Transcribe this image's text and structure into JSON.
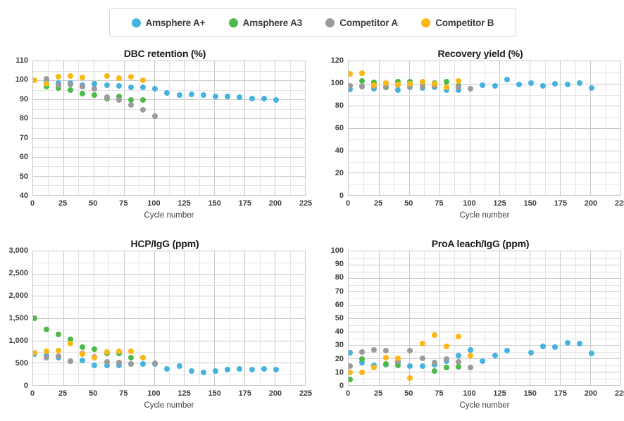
{
  "legend": {
    "items": [
      {
        "label": "Amsphere A+",
        "color": "#45b3e0",
        "key": "amsphere_a_plus"
      },
      {
        "label": "Amsphere A3",
        "color": "#4eb848",
        "key": "amsphere_a3"
      },
      {
        "label": "Competitor A",
        "color": "#9b9b9b",
        "key": "competitor_a"
      },
      {
        "label": "Competitor B",
        "color": "#fbb713",
        "key": "competitor_b"
      }
    ]
  },
  "colors": {
    "amsphere_a_plus": "#45b3e0",
    "amsphere_a3": "#4eb848",
    "competitor_a": "#9b9b9b",
    "competitor_b": "#fbb713",
    "grid_major": "#c9c9c9",
    "grid_minor": "#e4e4e4",
    "text": "#3f3f3f",
    "background": "#ffffff"
  },
  "chart_data": [
    {
      "id": "dbc",
      "type": "scatter",
      "title": "DBC retention (%)",
      "xlabel": "Cycle number",
      "ylabel": "",
      "xlim": [
        0,
        225
      ],
      "ylim": [
        40,
        110
      ],
      "xticks": [
        0,
        25,
        50,
        75,
        100,
        125,
        150,
        175,
        200,
        225
      ],
      "yticks": [
        40,
        50,
        60,
        70,
        80,
        90,
        100,
        110
      ],
      "grid": true,
      "legend_position": "top",
      "series": [
        {
          "name": "Amsphere A+",
          "color": "#45b3e0",
          "points": [
            [
              11,
              99.2
            ],
            [
              21,
              98.6
            ],
            [
              31,
              98.4
            ],
            [
              41,
              97.4
            ],
            [
              51,
              98.2
            ],
            [
              61,
              97.4
            ],
            [
              71,
              97.0
            ],
            [
              81,
              96.4
            ],
            [
              91,
              96.4
            ],
            [
              101,
              95.8
            ],
            [
              111,
              93.6
            ],
            [
              121,
              92.2
            ],
            [
              131,
              92.7
            ],
            [
              141,
              92.4
            ],
            [
              151,
              91.6
            ],
            [
              161,
              91.4
            ],
            [
              171,
              91.1
            ],
            [
              181,
              90.3
            ],
            [
              191,
              90.3
            ],
            [
              201,
              89.9
            ]
          ]
        },
        {
          "name": "Amsphere A3",
          "color": "#4eb848",
          "points": [
            [
              11,
              96.8
            ],
            [
              21,
              96.1
            ],
            [
              31,
              95.0
            ],
            [
              41,
              93.1
            ],
            [
              51,
              92.2
            ],
            [
              61,
              90.5
            ],
            [
              71,
              91.7
            ],
            [
              81,
              89.6
            ],
            [
              91,
              89.6
            ]
          ]
        },
        {
          "name": "Competitor A",
          "color": "#9b9b9b",
          "points": [
            [
              11,
              100.7
            ],
            [
              21,
              97.3
            ],
            [
              31,
              98.0
            ],
            [
              41,
              96.8
            ],
            [
              51,
              95.5
            ],
            [
              61,
              91.1
            ],
            [
              71,
              89.6
            ],
            [
              81,
              87.2
            ],
            [
              91,
              84.5
            ],
            [
              101,
              81.4
            ]
          ]
        },
        {
          "name": "Competitor B",
          "color": "#fbb713",
          "points": [
            [
              1,
              99.9
            ],
            [
              11,
              98.3
            ],
            [
              21,
              101.8
            ],
            [
              31,
              102.3
            ],
            [
              41,
              101.5
            ],
            [
              61,
              102.4
            ],
            [
              71,
              101.2
            ],
            [
              81,
              102.0
            ],
            [
              91,
              100.2
            ]
          ]
        }
      ]
    },
    {
      "id": "recovery",
      "type": "scatter",
      "title": "Recovery yield (%)",
      "xlabel": "Cycle number",
      "ylabel": "",
      "xlim": [
        0,
        225
      ],
      "ylim": [
        0,
        120
      ],
      "xticks": [
        0,
        25,
        50,
        75,
        100,
        125,
        150,
        175,
        200,
        225
      ],
      "yticks": [
        0,
        20,
        40,
        60,
        80,
        100,
        120
      ],
      "grid": true,
      "legend_position": "top",
      "series": [
        {
          "name": "Amsphere A+",
          "color": "#45b3e0",
          "points": [
            [
              1,
              94.6
            ],
            [
              11,
              97.2
            ],
            [
              21,
              95.2
            ],
            [
              31,
              96.4
            ],
            [
              41,
              93.8
            ],
            [
              51,
              96.4
            ],
            [
              61,
              95.8
            ],
            [
              71,
              96.4
            ],
            [
              81,
              94.4
            ],
            [
              91,
              93.8
            ],
            [
              111,
              98.6
            ],
            [
              121,
              97.6
            ],
            [
              131,
              103.4
            ],
            [
              141,
              99.4
            ],
            [
              151,
              100.4
            ],
            [
              161,
              97.8
            ],
            [
              171,
              99.6
            ],
            [
              181,
              99.0
            ],
            [
              191,
              100.6
            ],
            [
              201,
              96.2
            ]
          ]
        },
        {
          "name": "Amsphere A3",
          "color": "#4eb848",
          "points": [
            [
              11,
              102.6
            ],
            [
              21,
              100.8
            ],
            [
              31,
              96.8
            ],
            [
              41,
              101.6
            ],
            [
              51,
              101.6
            ],
            [
              61,
              100.8
            ],
            [
              71,
              100.4
            ],
            [
              81,
              101.8
            ],
            [
              91,
              98.2
            ]
          ]
        },
        {
          "name": "Competitor A",
          "color": "#9b9b9b",
          "points": [
            [
              1,
              97.6
            ],
            [
              11,
              97.4
            ],
            [
              21,
              97.0
            ],
            [
              31,
              97.4
            ],
            [
              41,
              98.6
            ],
            [
              51,
              97.4
            ],
            [
              61,
              97.2
            ],
            [
              71,
              97.8
            ],
            [
              81,
              96.6
            ],
            [
              91,
              96.8
            ],
            [
              101,
              95.4
            ]
          ]
        },
        {
          "name": "Competitor B",
          "color": "#fbb713",
          "points": [
            [
              1,
              108.6
            ],
            [
              11,
              109.4
            ],
            [
              21,
              98.6
            ],
            [
              31,
              100.4
            ],
            [
              41,
              99.4
            ],
            [
              51,
              99.6
            ],
            [
              61,
              101.4
            ],
            [
              71,
              99.6
            ],
            [
              81,
              96.4
            ],
            [
              91,
              102.4
            ]
          ]
        }
      ]
    },
    {
      "id": "hcp",
      "type": "scatter",
      "title": "HCP/IgG (ppm)",
      "xlabel": "Cycle number",
      "ylabel": "",
      "xlim": [
        0,
        225
      ],
      "ylim": [
        0,
        3000
      ],
      "xticks": [
        0,
        25,
        50,
        75,
        100,
        125,
        150,
        175,
        200,
        225
      ],
      "yticks": [
        0,
        500,
        1000,
        1500,
        2000,
        2500,
        3000
      ],
      "ytick_labels": [
        "0",
        "500",
        "1,000",
        "1,500",
        "2,000",
        "2,500",
        "3,000"
      ],
      "grid": true,
      "legend_position": "top",
      "series": [
        {
          "name": "Amsphere A+",
          "color": "#45b3e0",
          "points": [
            [
              1,
              690
            ],
            [
              11,
              660
            ],
            [
              21,
              610
            ],
            [
              31,
              535
            ],
            [
              41,
              545
            ],
            [
              51,
              445
            ],
            [
              61,
              450
            ],
            [
              71,
              440
            ],
            [
              81,
              470
            ],
            [
              91,
              470
            ],
            [
              101,
              475
            ],
            [
              111,
              370
            ],
            [
              121,
              430
            ],
            [
              131,
              310
            ],
            [
              141,
              290
            ],
            [
              151,
              320
            ],
            [
              161,
              355
            ],
            [
              171,
              370
            ],
            [
              181,
              345
            ],
            [
              191,
              365
            ],
            [
              201,
              355
            ]
          ]
        },
        {
          "name": "Amsphere A3",
          "color": "#4eb848",
          "points": [
            [
              1,
              1500
            ],
            [
              11,
              1245
            ],
            [
              21,
              1135
            ],
            [
              31,
              1030
            ],
            [
              41,
              860
            ],
            [
              51,
              800
            ],
            [
              61,
              715
            ],
            [
              71,
              710
            ],
            [
              81,
              610
            ]
          ]
        },
        {
          "name": "Competitor A",
          "color": "#9b9b9b",
          "points": [
            [
              11,
              610
            ],
            [
              21,
              655
            ],
            [
              31,
              540
            ],
            [
              41,
              710
            ],
            [
              51,
              630
            ],
            [
              61,
              520
            ],
            [
              71,
              500
            ],
            [
              81,
              480
            ],
            [
              91,
              620
            ],
            [
              101,
              490
            ]
          ]
        },
        {
          "name": "Competitor B",
          "color": "#fbb713",
          "points": [
            [
              1,
              725
            ],
            [
              11,
              760
            ],
            [
              21,
              780
            ],
            [
              31,
              930
            ],
            [
              41,
              690
            ],
            [
              51,
              620
            ],
            [
              61,
              740
            ],
            [
              71,
              755
            ],
            [
              81,
              765
            ],
            [
              91,
              610
            ]
          ]
        }
      ]
    },
    {
      "id": "proa",
      "type": "scatter",
      "title": "ProA leach/IgG (ppm)",
      "xlabel": "Cycle number",
      "ylabel": "",
      "xlim": [
        0,
        225
      ],
      "ylim": [
        0,
        100
      ],
      "xticks": [
        0,
        25,
        50,
        75,
        100,
        125,
        150,
        175,
        200,
        225
      ],
      "yticks": [
        0,
        10,
        20,
        30,
        40,
        50,
        60,
        70,
        80,
        90,
        100
      ],
      "grid": true,
      "legend_position": "top",
      "series": [
        {
          "name": "Amsphere A+",
          "color": "#45b3e0",
          "points": [
            [
              1,
              24.0
            ],
            [
              11,
              17.0
            ],
            [
              21,
              14.5
            ],
            [
              31,
              15.3
            ],
            [
              41,
              16.8
            ],
            [
              51,
              14.2
            ],
            [
              61,
              14.4
            ],
            [
              71,
              15.3
            ],
            [
              81,
              18.0
            ],
            [
              91,
              22.2
            ],
            [
              101,
              26.3
            ],
            [
              111,
              18.0
            ],
            [
              121,
              22.2
            ],
            [
              131,
              26.0
            ],
            [
              151,
              24.4
            ],
            [
              161,
              29.0
            ],
            [
              171,
              28.6
            ],
            [
              181,
              31.4
            ],
            [
              191,
              31.2
            ],
            [
              201,
              23.6
            ]
          ]
        },
        {
          "name": "Amsphere A3",
          "color": "#4eb848",
          "points": [
            [
              1,
              4.3
            ],
            [
              11,
              19.4
            ],
            [
              31,
              16.0
            ],
            [
              41,
              15.0
            ],
            [
              71,
              10.4
            ],
            [
              81,
              13.2
            ],
            [
              91,
              13.6
            ]
          ]
        },
        {
          "name": "Competitor A",
          "color": "#9b9b9b",
          "points": [
            [
              1,
              14.4
            ],
            [
              11,
              24.6
            ],
            [
              21,
              26.4
            ],
            [
              31,
              25.6
            ],
            [
              41,
              17.8
            ],
            [
              51,
              25.6
            ],
            [
              61,
              20.0
            ],
            [
              71,
              16.6
            ],
            [
              81,
              19.4
            ],
            [
              91,
              17.4
            ],
            [
              101,
              13.2
            ]
          ]
        },
        {
          "name": "Competitor B",
          "color": "#fbb713",
          "points": [
            [
              1,
              9.6
            ],
            [
              11,
              9.6
            ],
            [
              21,
              13.4
            ],
            [
              31,
              20.6
            ],
            [
              41,
              20.0
            ],
            [
              51,
              5.4
            ],
            [
              61,
              31.2
            ],
            [
              71,
              37.4
            ],
            [
              81,
              28.8
            ],
            [
              91,
              36.2
            ],
            [
              101,
              22.2
            ]
          ]
        }
      ]
    }
  ]
}
